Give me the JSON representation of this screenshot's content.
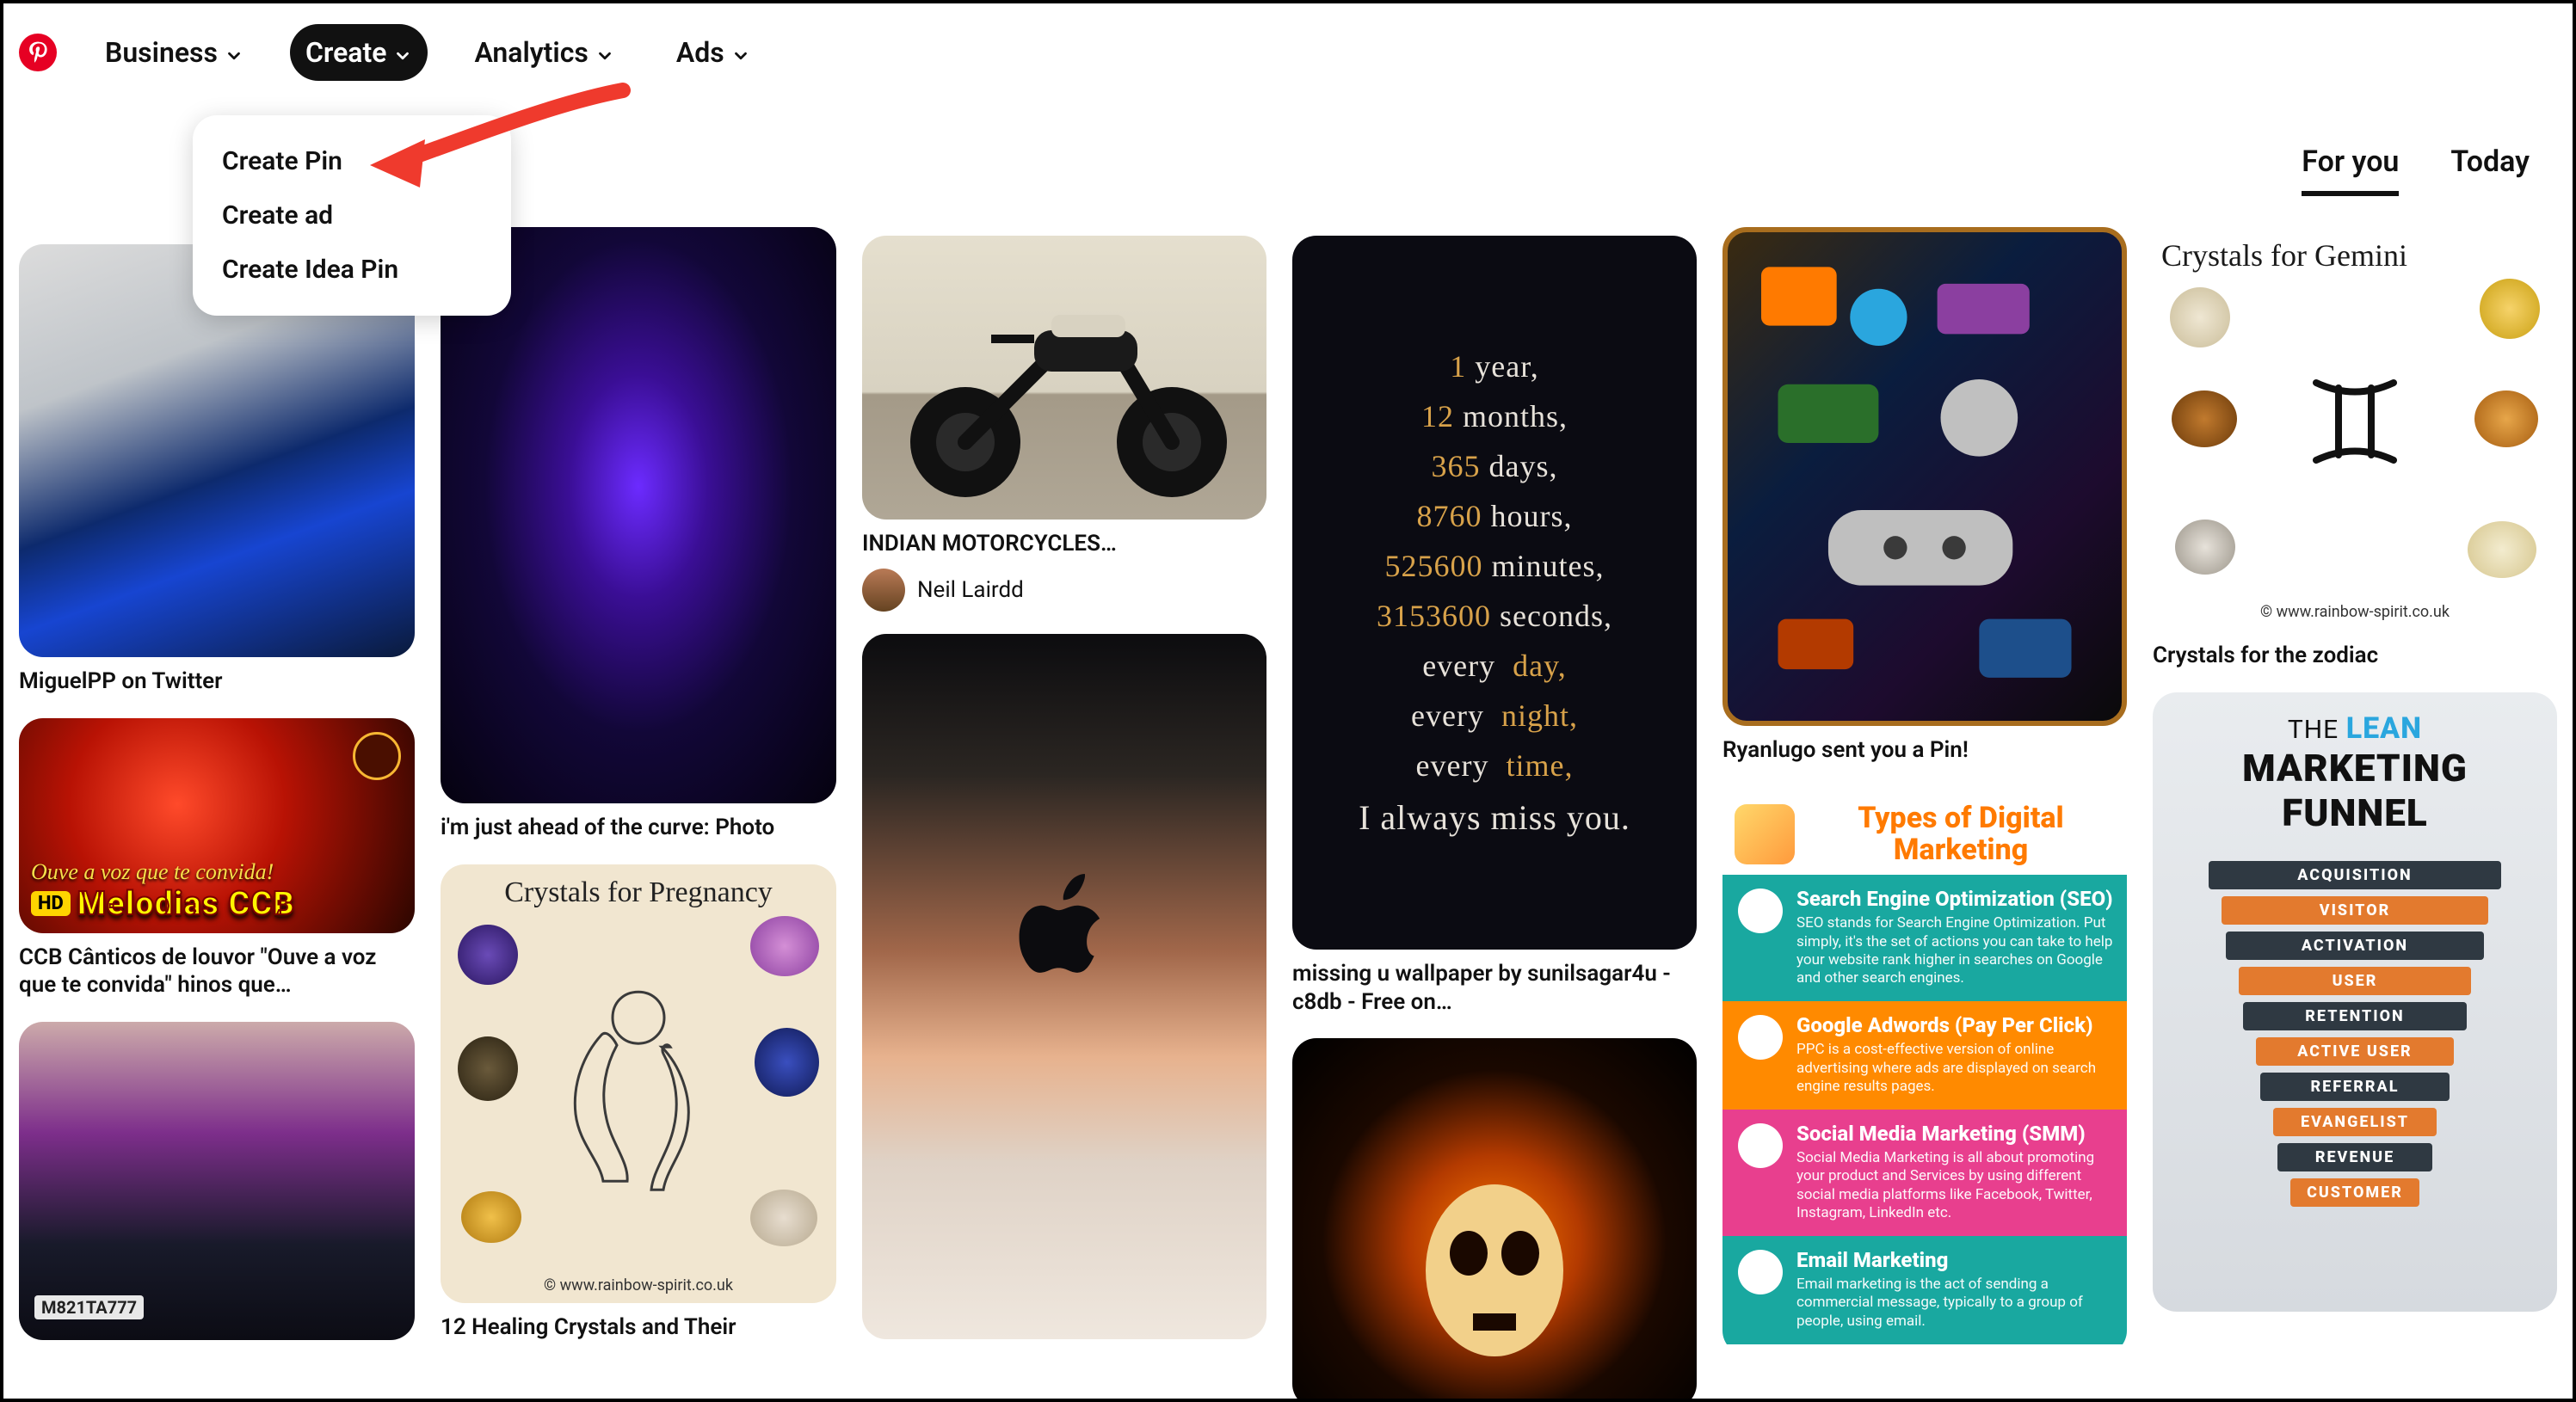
{
  "nav": {
    "business": "Business",
    "create": "Create",
    "analytics": "Analytics",
    "ads": "Ads"
  },
  "create_menu": {
    "pin": "Create Pin",
    "ad": "Create ad",
    "idea": "Create Idea Pin"
  },
  "feed_tabs": {
    "for_you": "For you",
    "today": "Today"
  },
  "col1": {
    "lambo_title": "MiguelPP on Twitter",
    "ccb_line1": "Ouve a voz que te convida!",
    "ccb_hd": "HD",
    "ccb_brand": "Melodias CCB",
    "ccb_title": "CCB Cânticos de louvor \"Ouve a voz que te convida\" hinos que…",
    "smoke_plate": "М821ТА777"
  },
  "col2": {
    "panther_title": "i'm just ahead of the curve: Photo",
    "preg_heading": "Crystals for Pregnancy",
    "preg_site": "© www.rainbow-spirit.co.uk",
    "preg_title": "12 Healing Crystals and Their"
  },
  "col3": {
    "moto_title": "INDIAN MOTORCYCLES…",
    "moto_user": "Neil Lairdd"
  },
  "col4": {
    "miss": {
      "l1a": "1",
      "l1b": "year,",
      "l2a": "12",
      "l2b": "months,",
      "l3a": "365",
      "l3b": "days,",
      "l4a": "8760",
      "l4b": "hours,",
      "l5a": "525600",
      "l5b": "minutes,",
      "l6a": "3153600",
      "l6b": "seconds,",
      "l7a": "every",
      "l7b": "day,",
      "l8a": "every",
      "l8b": "night,",
      "l9a": "every",
      "l9b": "time,",
      "l10": "I  always  miss  you."
    },
    "miss_title": "missing u wallpaper by sunilsagar4u - c8db - Free on…"
  },
  "col5": {
    "gamer_title": "Ryanlugo sent you a Pin!",
    "dm": {
      "heading": "Types of Digital Marketing",
      "seo_h": "Search Engine Optimization (SEO)",
      "seo_p": "SEO stands for Search Engine Optimization. Put simply, it's the set of actions you can take to help your website rank higher in searches on Google and other search engines.",
      "ppc_h": "Google Adwords (Pay Per Click)",
      "ppc_p": "PPC is a cost-effective version of online advertising where ads are displayed on search engine results pages.",
      "smm_h": "Social Media Marketing (SMM)",
      "smm_p": "Social Media Marketing is all about promoting your product and Services by using different social media platforms like Facebook, Twitter, Instagram, LinkedIn etc.",
      "em_h": "Email Marketing",
      "em_p": "Email marketing is the act of sending a commercial message, typically to a group of people, using email."
    }
  },
  "col6": {
    "gem_heading": "Crystals for Gemini",
    "gem_site": "© www.rainbow-spirit.co.uk",
    "gem_title": "Crystals for the zodiac",
    "fun_the": "THE",
    "fun_lean": "LEAN",
    "fun_mkt": "MARKETING",
    "fun_funnel": "FUNNEL",
    "fun_rows": {
      "r1a": "ACQUISITION",
      "r1b": "VISITOR",
      "r2a": "ACTIVATION",
      "r2b": "USER",
      "r3a": "RETENTION",
      "r3b": "ACTIVE USER",
      "r4a": "REFERRAL",
      "r4b": "EVANGELIST",
      "r5a": "REVENUE",
      "r5b": "CUSTOMER"
    }
  }
}
